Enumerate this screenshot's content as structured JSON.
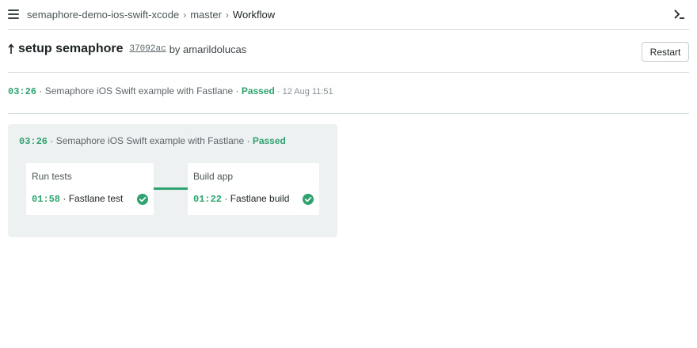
{
  "topbar": {
    "breadcrumb": {
      "project": "semaphore-demo-ios-swift-xcode",
      "sep1": "›",
      "branch": "master",
      "sep2": "›",
      "current": "Workflow"
    },
    "menu_icon": "hamburger-icon",
    "terminal_icon": "terminal-icon"
  },
  "workflow": {
    "title": "setup semaphore",
    "commit_sha": "37092ac",
    "by_label": "by amarildolucas",
    "restart_label": "Restart",
    "up_icon": "arrow-up-icon"
  },
  "summary": {
    "duration": "03:26",
    "sep1": " · ",
    "name": "Semaphore iOS Swift example with Fastlane",
    "sep2": " · ",
    "status": "Passed",
    "sep3": " · ",
    "timestamp": "12 Aug 11:51"
  },
  "pipeline": {
    "duration": "03:26",
    "sep1": " · ",
    "name": "Semaphore iOS Swift example with Fastlane",
    "sep2": " · ",
    "status": "Passed",
    "blocks": [
      {
        "title": "Run tests",
        "job_time": "01:58",
        "sep": " · ",
        "job_name": "Fastlane test"
      },
      {
        "title": "Build app",
        "job_time": "01:22",
        "sep": " · ",
        "job_name": "Fastlane build"
      }
    ]
  },
  "colors": {
    "accent_green": "#2ea370",
    "pipeline_bg": "#eef1f2",
    "rule": "#d8dfe1"
  }
}
